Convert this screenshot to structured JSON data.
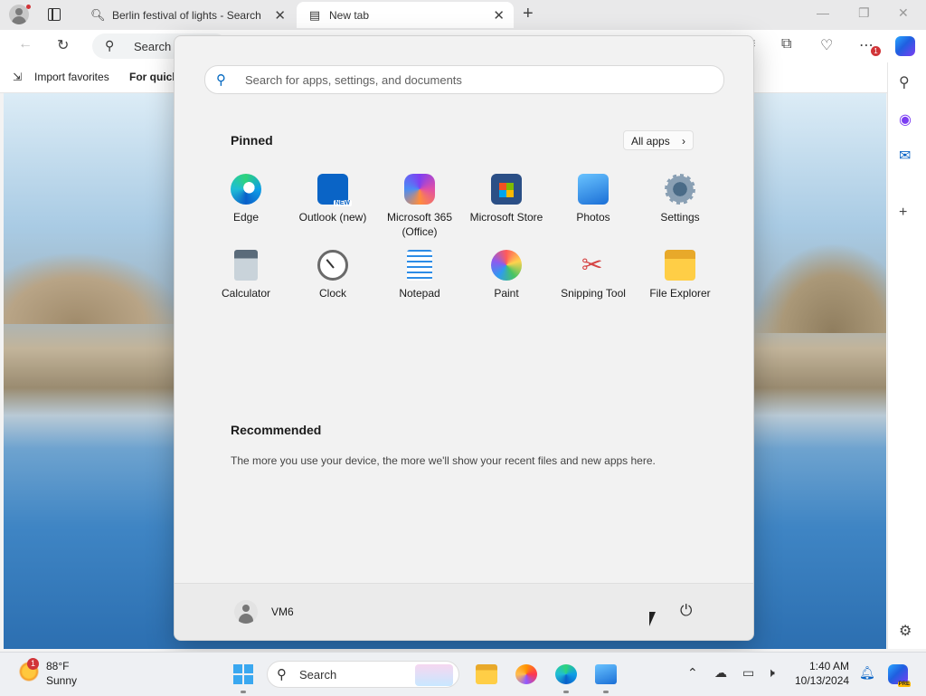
{
  "browser": {
    "tabs": [
      {
        "title": "Berlin festival of lights - Search",
        "icon": "search-icon"
      },
      {
        "title": "New tab",
        "icon": "newtab-page-icon"
      }
    ],
    "address_placeholder": "Search",
    "favorites": {
      "import_label": "Import favorites",
      "quick_label": "For quick"
    },
    "menu_badge": "1"
  },
  "start_menu": {
    "search_placeholder": "Search for apps, settings, and documents",
    "pinned_heading": "Pinned",
    "all_apps_label": "All apps",
    "pinned_apps": [
      {
        "name": "Edge",
        "icon": "edge-icon"
      },
      {
        "name": "Outlook (new)",
        "icon": "outlook-icon"
      },
      {
        "name": "Microsoft 365 (Office)",
        "icon": "m365-icon"
      },
      {
        "name": "Microsoft Store",
        "icon": "store-icon"
      },
      {
        "name": "Photos",
        "icon": "photos-icon"
      },
      {
        "name": "Settings",
        "icon": "settings-icon"
      },
      {
        "name": "Calculator",
        "icon": "calculator-icon"
      },
      {
        "name": "Clock",
        "icon": "clock-icon"
      },
      {
        "name": "Notepad",
        "icon": "notepad-icon"
      },
      {
        "name": "Paint",
        "icon": "paint-icon"
      },
      {
        "name": "Snipping Tool",
        "icon": "snipping-tool-icon"
      },
      {
        "name": "File Explorer",
        "icon": "file-explorer-icon"
      }
    ],
    "recommended_heading": "Recommended",
    "recommended_text": "The more you use your device, the more we'll show your recent files and new apps here.",
    "user_name": "VM6"
  },
  "taskbar": {
    "weather": {
      "temp": "88°F",
      "condition": "Sunny",
      "badge": "1"
    },
    "search_label": "Search",
    "time": "1:40 AM",
    "date": "10/13/2024",
    "copilot_badge": "PRE"
  }
}
